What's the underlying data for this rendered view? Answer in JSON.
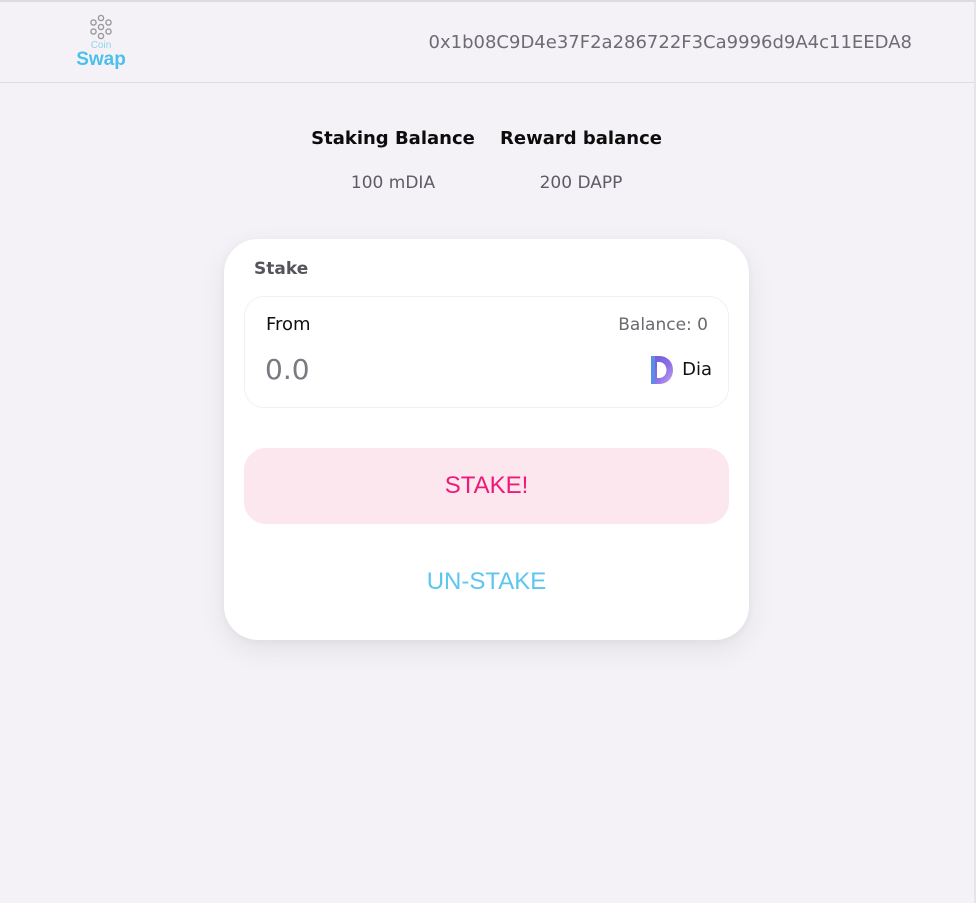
{
  "header": {
    "logo_small": "Coin",
    "logo_large": "Swap",
    "wallet_address": "0x1b08C9D4e37F2a286722F3Ca9996d9A4c11EEDA8"
  },
  "balances": {
    "staking_label": "Staking Balance",
    "staking_value": "100 mDIA",
    "reward_label": "Reward balance",
    "reward_value": "200 DAPP"
  },
  "stake_card": {
    "title": "Stake",
    "from_label": "From",
    "balance_text": "Balance: 0",
    "amount_placeholder": "0.0",
    "token_icon": "dia-token-icon",
    "token_name": "Dia",
    "stake_button_label": "STAKE!",
    "unstake_button_label": "UN-STAKE"
  },
  "colors": {
    "background": "#f4f2f6",
    "stake_text": "#ec1a7a",
    "stake_bg": "#fce7ef",
    "unstake_text": "#5cc6ee",
    "logo_blue": "#4cc0ea"
  }
}
